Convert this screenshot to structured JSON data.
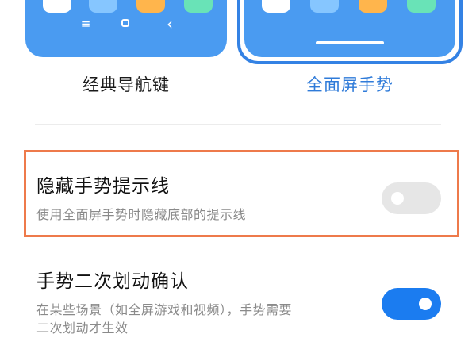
{
  "nav_styles": {
    "classic": {
      "label": "经典导航键",
      "app_icon_colors": [
        "#ffffff",
        "#86c6ff",
        "#ffb54c",
        "#69e3b7"
      ],
      "nav_keys": {
        "menu": "≡",
        "back": "‹"
      },
      "selected": false
    },
    "gesture": {
      "label": "全面屏手势",
      "app_icon_colors": [
        "#ffffff",
        "#86c6ff",
        "#ffb54c",
        "#69e3b7"
      ],
      "selected": true
    },
    "accent_color": "#2f7bd9",
    "preview_color": "#4a9bf1"
  },
  "settings": {
    "hide_hint_line": {
      "title": "隐藏手势提示线",
      "description": "使用全面屏手势时隐藏底部的提示线",
      "enabled": false,
      "highlighted": true,
      "highlight_color": "#ee7a4b"
    },
    "double_swipe_confirm": {
      "title": "手势二次划动确认",
      "description_line1": "在某些场景（如全屏游戏和视频），手势需要",
      "description_line2": "二次划动才生效",
      "enabled": true,
      "toggle_color": "#1b7cf0"
    }
  }
}
